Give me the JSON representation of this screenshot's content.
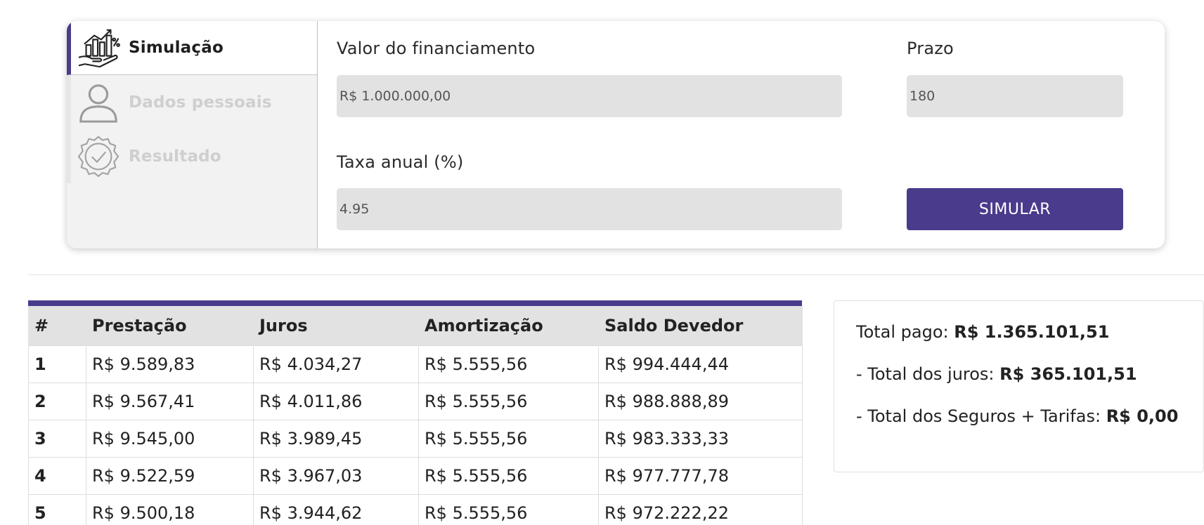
{
  "steps": [
    {
      "label": "Simulação",
      "icon": "finance-chart-hand-icon",
      "active": true
    },
    {
      "label": "Dados pessoais",
      "icon": "user-icon",
      "active": false
    },
    {
      "label": "Resultado",
      "icon": "check-badge-icon",
      "active": false
    }
  ],
  "form": {
    "valor_label": "Valor do financiamento",
    "valor_value": "R$ 1.000.000,00",
    "prazo_label": "Prazo",
    "prazo_value": "180",
    "taxa_label": "Taxa anual (%)",
    "taxa_value": "4.95",
    "simular_button": "SIMULAR"
  },
  "table": {
    "headers": [
      "#",
      "Prestação",
      "Juros",
      "Amortização",
      "Saldo Devedor"
    ],
    "rows": [
      [
        "1",
        "R$ 9.589,83",
        "R$ 4.034,27",
        "R$ 5.555,56",
        "R$ 994.444,44"
      ],
      [
        "2",
        "R$ 9.567,41",
        "R$ 4.011,86",
        "R$ 5.555,56",
        "R$ 988.888,89"
      ],
      [
        "3",
        "R$ 9.545,00",
        "R$ 3.989,45",
        "R$ 5.555,56",
        "R$ 983.333,33"
      ],
      [
        "4",
        "R$ 9.522,59",
        "R$ 3.967,03",
        "R$ 5.555,56",
        "R$ 977.777,78"
      ],
      [
        "5",
        "R$ 9.500,18",
        "R$ 3.944,62",
        "R$ 5.555,56",
        "R$ 972.222,22"
      ]
    ]
  },
  "totals": {
    "total_pago_label": "Total pago:",
    "total_pago_value": "R$ 1.365.101,51",
    "total_juros_label": "- Total dos juros:",
    "total_juros_value": "R$ 365.101,51",
    "total_seguros_label": "- Total dos Seguros + Tarifas:",
    "total_seguros_value": "R$ 0,00"
  },
  "colors": {
    "accent": "#4a3b8c",
    "input_bg": "#e2e2e2",
    "inactive_text": "#cfcfcf"
  }
}
